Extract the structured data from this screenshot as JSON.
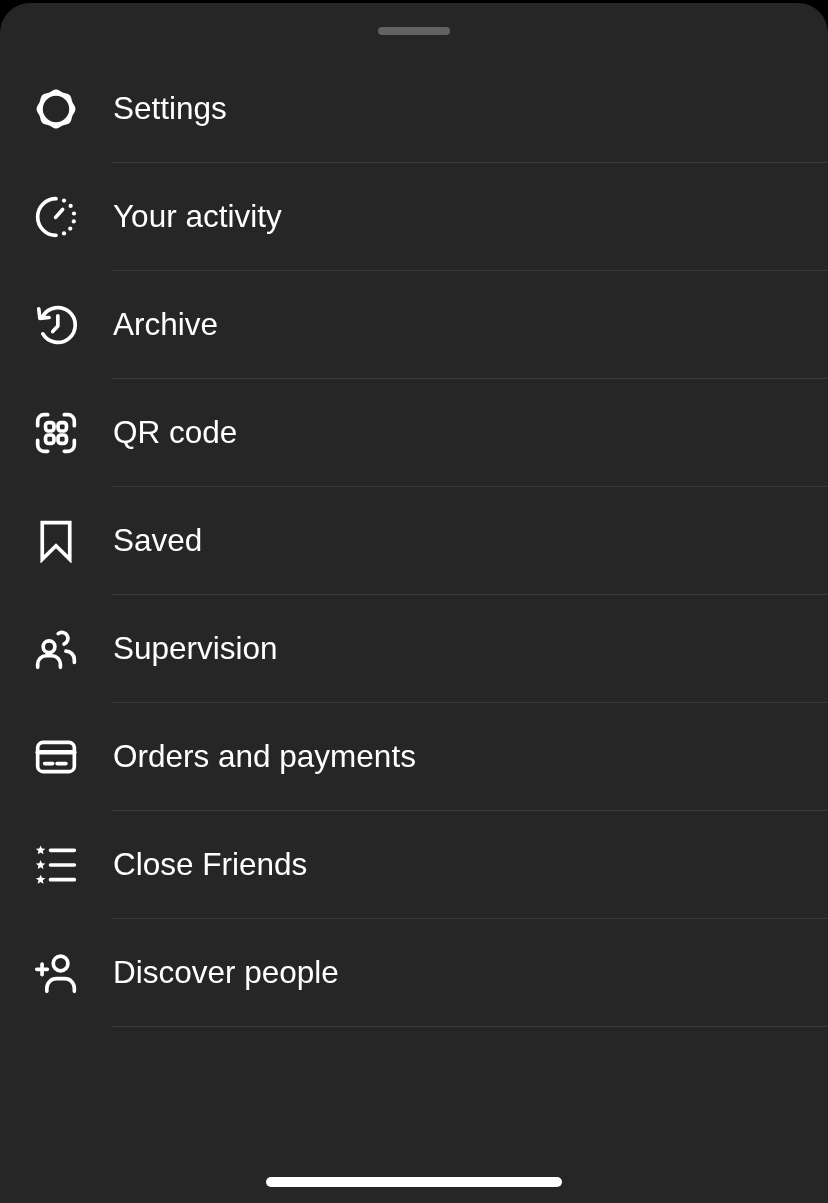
{
  "sheet": {
    "items": [
      {
        "label": "Settings"
      },
      {
        "label": "Your activity"
      },
      {
        "label": "Archive"
      },
      {
        "label": "QR code"
      },
      {
        "label": "Saved"
      },
      {
        "label": "Supervision"
      },
      {
        "label": "Orders and payments"
      },
      {
        "label": "Close Friends"
      },
      {
        "label": "Discover people"
      }
    ]
  }
}
